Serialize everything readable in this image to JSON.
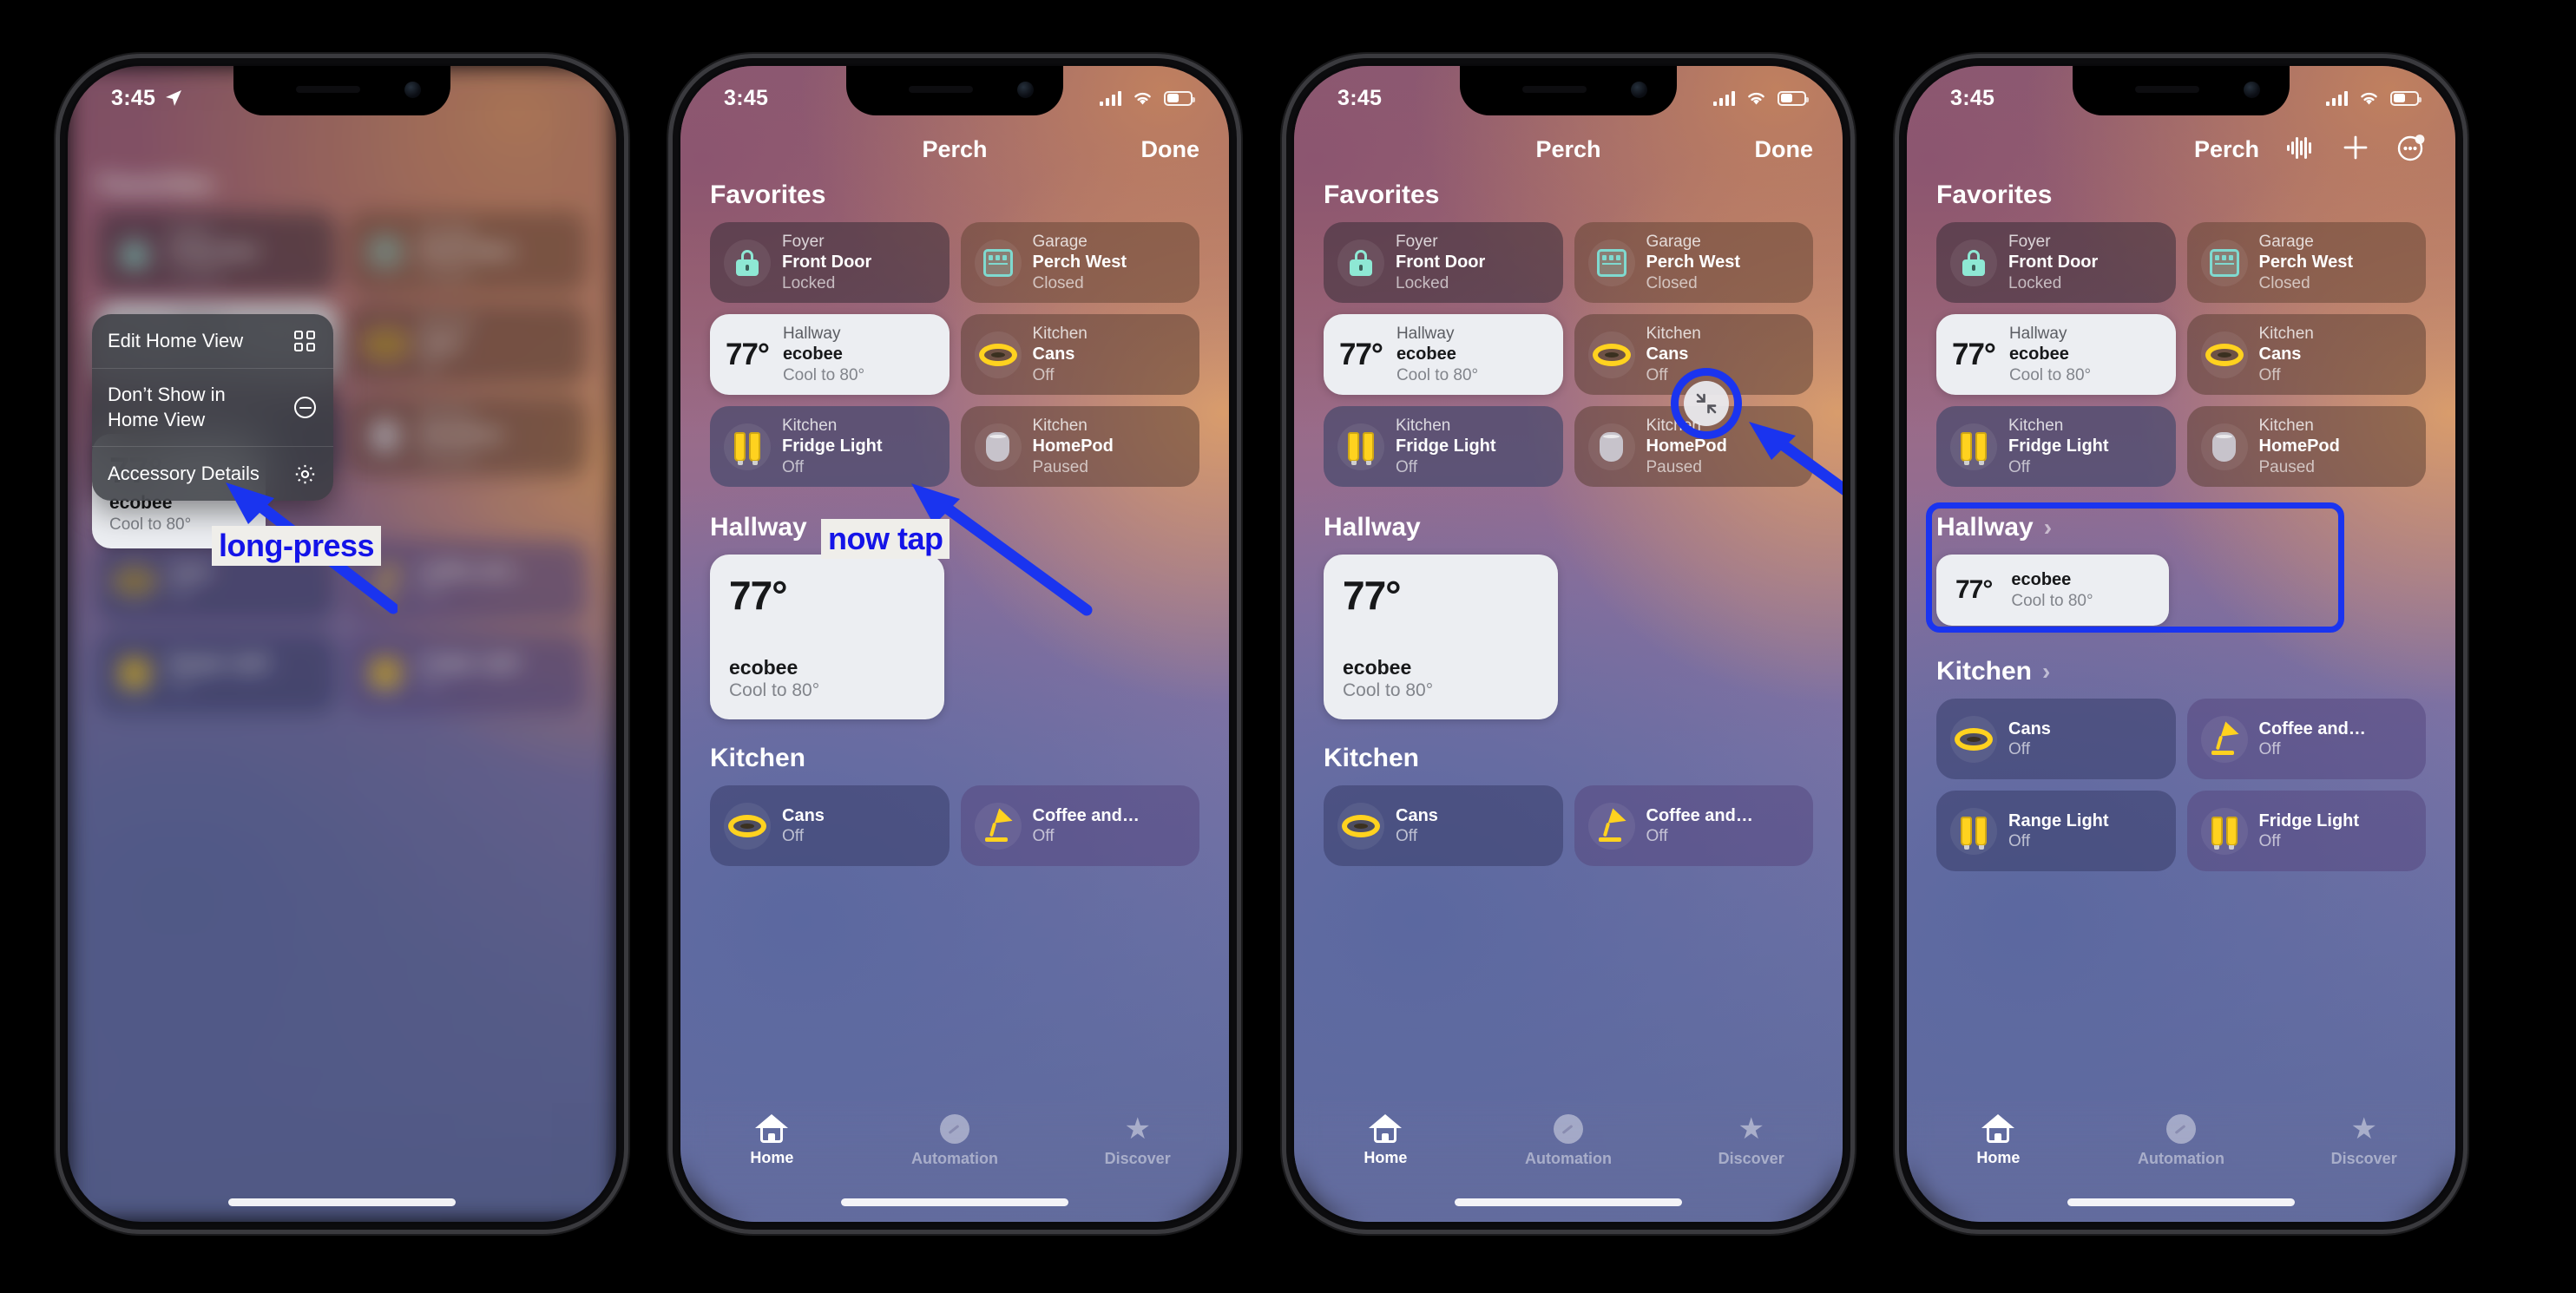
{
  "status_bar": {
    "time": "3:45",
    "location_icon": "location-arrow-icon",
    "wifi_icon": "wifi-icon",
    "cellular_icon": "cellular-bars-icon",
    "battery_icon": "battery-icon"
  },
  "nav": {
    "title": "Perch",
    "done_label": "Done",
    "icons": [
      {
        "name": "audio-waveform-icon",
        "glyph": "waveform"
      },
      {
        "name": "add-icon",
        "glyph": "plus"
      },
      {
        "name": "more-options-icon",
        "glyph": "ellipsis-circle"
      }
    ]
  },
  "sections": {
    "favorites_label": "Favorites",
    "hallway_label": "Hallway",
    "kitchen_label": "Kitchen",
    "chevron": "›"
  },
  "favorites_tiles": [
    {
      "room": "Foyer",
      "name": "Front Door",
      "state": "Locked",
      "icon": "lock-icon",
      "style": "t-dark"
    },
    {
      "room": "Garage",
      "name": "Perch West",
      "state": "Closed",
      "icon": "garage-door-icon",
      "style": "t-warm"
    },
    {
      "room": "Kitchen",
      "name": "Cans",
      "state": "Off",
      "icon": "can-light-icon",
      "style": "t-brown"
    },
    {
      "room": "Kitchen",
      "name": "Fridge Light",
      "state": "Off",
      "icon": "light-bulb-icon",
      "style": "t-blue"
    },
    {
      "room": "Kitchen",
      "name": "HomePod",
      "state": "Paused",
      "icon": "homepod-icon",
      "style": "t-brown"
    }
  ],
  "thermostat": {
    "room": "Hallway",
    "name": "ecobee",
    "temperature": "77°",
    "state": "Cool to 80°"
  },
  "kitchen_tiles_short": [
    {
      "name": "Cans",
      "state": "Off",
      "icon": "can-light-icon",
      "style": "t-navy"
    },
    {
      "name": "Coffee and…",
      "state": "Off",
      "icon": "lamp-icon",
      "style": "t-purple"
    }
  ],
  "kitchen_tiles_full": [
    {
      "name": "Cans",
      "state": "Off",
      "icon": "can-light-icon",
      "style": "t-navy"
    },
    {
      "name": "Coffee and…",
      "state": "Off",
      "icon": "lamp-icon",
      "style": "t-purple"
    },
    {
      "name": "Range Light",
      "state": "Off",
      "icon": "light-bulb-icon",
      "style": "t-navy"
    },
    {
      "name": "Fridge Light",
      "state": "Off",
      "icon": "light-bulb-icon",
      "style": "t-purple"
    }
  ],
  "context_menu": [
    {
      "label": "Edit Home View",
      "icon": "grid-icon"
    },
    {
      "label": "Don’t Show in\nHome View",
      "icon": "minus-circle-icon"
    },
    {
      "label": "Accessory Details",
      "icon": "gear-icon"
    }
  ],
  "tab_bar": [
    {
      "label": "Home",
      "icon": "home-icon",
      "active": true
    },
    {
      "label": "Automation",
      "icon": "clock-icon",
      "active": false
    },
    {
      "label": "Discover",
      "icon": "star-icon",
      "active": false
    }
  ],
  "annotations": {
    "long_press": "long-press",
    "now_tap": "now tap",
    "arrow_color": "#1a34ef",
    "label_bg": "#efeeea",
    "label_fg": "#1414e8",
    "collapse_glyph": "↙↗"
  }
}
